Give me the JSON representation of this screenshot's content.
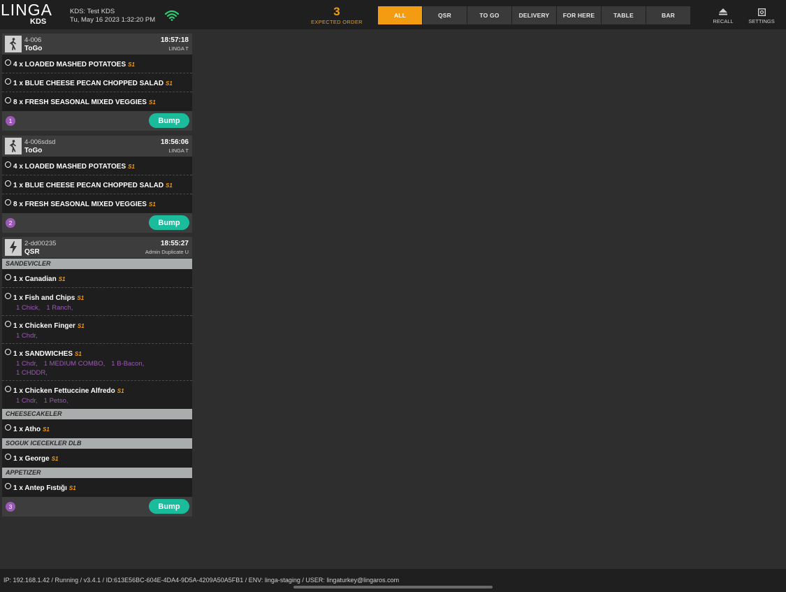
{
  "app": {
    "logo_main": "LINGA",
    "logo_sub": "KDS",
    "kds_name": "KDS: Test KDS",
    "datetime": "Tu, May 16 2023 1:32:20 PM"
  },
  "expected": {
    "count": "3",
    "label": "EXPECTED ORDER"
  },
  "tabs": [
    {
      "label": "ALL",
      "active": true
    },
    {
      "label": "QSR"
    },
    {
      "label": "TO GO"
    },
    {
      "label": "DELIVERY"
    },
    {
      "label": "FOR HERE"
    },
    {
      "label": "TABLE"
    },
    {
      "label": "BAR"
    }
  ],
  "actions": {
    "recall": "RECALL",
    "settings": "SETTINGS"
  },
  "orders": [
    {
      "id": "4-006",
      "type": "ToGo",
      "time": "18:57:18",
      "user": "LINGA T",
      "number": "1",
      "bump": "Bump",
      "items": [
        {
          "text": "4 x LOADED MASHED POTATOES",
          "seat": "S1"
        },
        {
          "text": "1 x BLUE CHEESE PECAN CHOPPED SALAD",
          "seat": "S1"
        },
        {
          "text": "8 x FRESH SEASONAL MIXED VEGGIES",
          "seat": "S1"
        }
      ]
    },
    {
      "id": "4-006sdsd",
      "type": "ToGo",
      "time": "18:56:06",
      "user": "LINGA T",
      "number": "2",
      "bump": "Bump",
      "items": [
        {
          "text": "4 x LOADED MASHED POTATOES",
          "seat": "S1"
        },
        {
          "text": "1 x BLUE CHEESE PECAN CHOPPED SALAD",
          "seat": "S1"
        },
        {
          "text": "8 x FRESH SEASONAL MIXED VEGGIES",
          "seat": "S1"
        }
      ]
    },
    {
      "id": "2-dd00235",
      "type": "QSR",
      "time": "18:55:27",
      "user": "Admin Duplicate U",
      "number": "3",
      "bump": "Bump",
      "categories": [
        {
          "name": "SANDEVICLER",
          "items": [
            {
              "text": "1 x Canadian",
              "seat": "S1"
            },
            {
              "text": "1 x Fish and Chips",
              "seat": "S1",
              "mods": [
                "1 Chick,",
                "1 Ranch,"
              ]
            },
            {
              "text": "1 x Chicken Finger",
              "seat": "S1",
              "mods": [
                "1 Chdr,"
              ]
            },
            {
              "text": "1 x SANDWICHES",
              "seat": "S1",
              "mods": [
                "1 Chdr,",
                "1 MEDIUM COMBO,",
                "1 B-Bacon,"
              ],
              "mods2": [
                "1 CHDDR,"
              ]
            },
            {
              "text": "1 x Chicken Fettuccine Alfredo",
              "seat": "S1",
              "mods": [
                "1 Chdr,",
                "1 Petso,"
              ]
            }
          ]
        },
        {
          "name": "CHEESECAKELER",
          "items": [
            {
              "text": "1 x Atho",
              "seat": "S1"
            }
          ]
        },
        {
          "name": "SOGUK ICECEKLER DLB",
          "items": [
            {
              "text": "1 x George",
              "seat": "S1"
            }
          ]
        },
        {
          "name": "APPETIZER",
          "items": [
            {
              "text": "1 x Antep Fıstığı",
              "seat": "S1"
            }
          ]
        }
      ]
    }
  ],
  "footer": {
    "status": "IP: 192.168.1.42 / Running / v3.4.1  / ID:613E56BC-604E-4DA4-9D5A-4209A50A5FB1  / ENV: linga-staging / USER: lingaturkey@lingaros.com"
  },
  "colors": {
    "accent": "#f39c12",
    "bump": "#1abc9c",
    "modifier": "#9b59b6"
  },
  "icons": {
    "togo": "walking-person-icon",
    "qsr": "lightning-icon",
    "wifi": "wifi-icon",
    "recall": "recall-icon",
    "settings": "gear-icon"
  }
}
